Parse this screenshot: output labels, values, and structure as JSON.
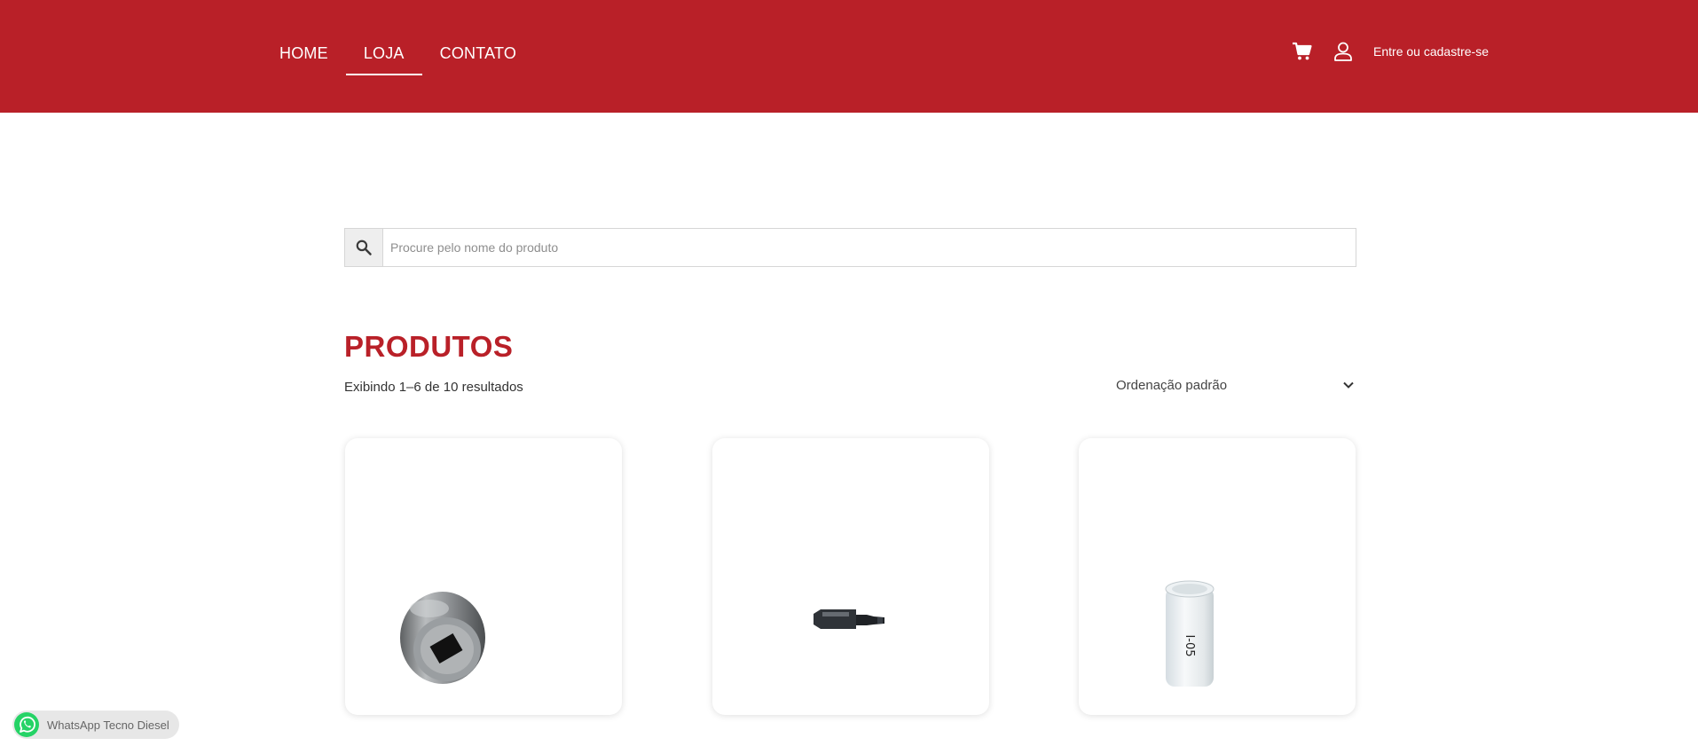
{
  "nav": {
    "items": [
      {
        "label": "HOME",
        "active": false
      },
      {
        "label": "LOJA",
        "active": true
      },
      {
        "label": "CONTATO",
        "active": false
      }
    ]
  },
  "header": {
    "login_label": "Entre ou cadastre-se",
    "icons": [
      "cart-icon",
      "user-icon"
    ],
    "background_color": "#b92028"
  },
  "search": {
    "placeholder": "Procure pelo nome do produto",
    "value": "",
    "icon": "search-icon"
  },
  "main": {
    "title": "PRODUTOS",
    "title_color": "#b92028",
    "result_count": "Exibindo 1–6 de 10 resultados",
    "sort": {
      "selected": "Ordenação padrão",
      "icon": "chevron-down-icon"
    }
  },
  "products": [
    {
      "image": "metal-socket-tool"
    },
    {
      "image": "torx-screwdriver-bit"
    },
    {
      "image": "white-plastic-sleeve",
      "image_text": "I-05"
    }
  ],
  "whatsapp": {
    "label": "WhatsApp Tecno Diesel",
    "color": "#25d366",
    "icon": "whatsapp-icon"
  }
}
